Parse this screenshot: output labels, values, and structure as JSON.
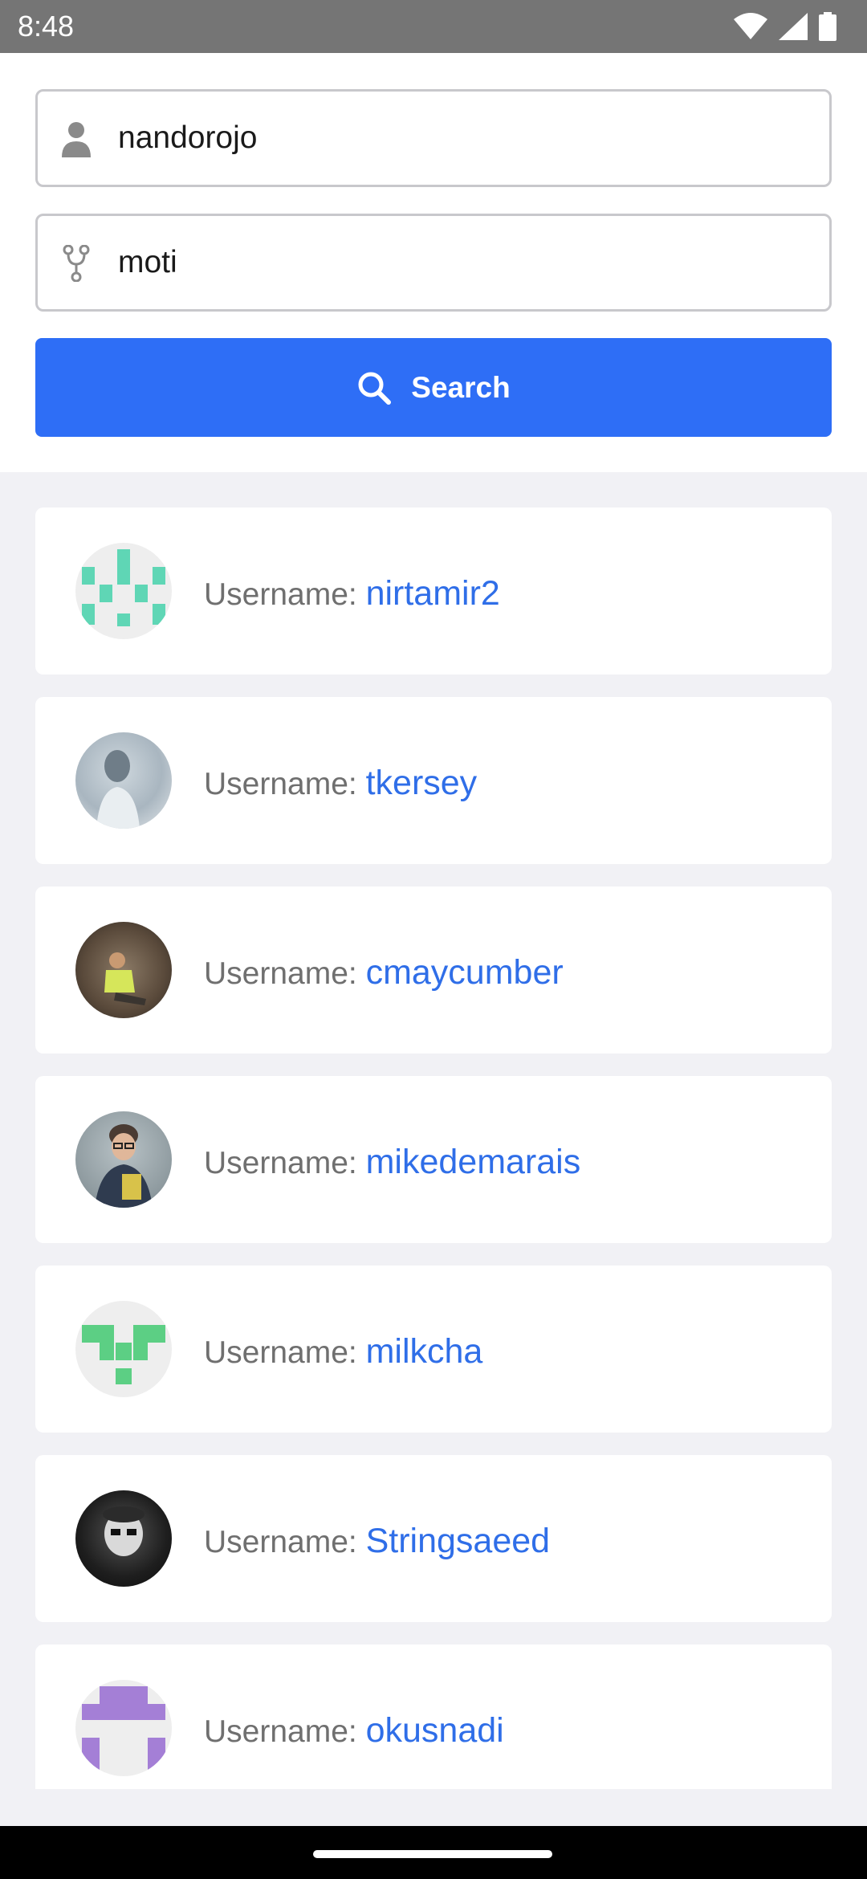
{
  "status_bar": {
    "time": "8:48",
    "icons": [
      "wifi-icon",
      "signal-icon",
      "battery-icon"
    ]
  },
  "form": {
    "username_field": {
      "value": "nandorojo",
      "icon": "person-icon"
    },
    "repo_field": {
      "value": "moti",
      "icon": "git-fork-icon"
    },
    "search_button": {
      "label": "Search",
      "icon": "search-icon",
      "color": "#2e6ef6"
    }
  },
  "results": {
    "label_prefix": "Username:",
    "accent_color": "#2f6ee8",
    "items": [
      {
        "username": "nirtamir2",
        "avatar": "identicon-green"
      },
      {
        "username": "tkersey",
        "avatar": "photo"
      },
      {
        "username": "cmaycumber",
        "avatar": "photo"
      },
      {
        "username": "mikedemarais",
        "avatar": "photo"
      },
      {
        "username": "milkcha",
        "avatar": "identicon-green"
      },
      {
        "username": "Stringsaeed",
        "avatar": "photo"
      },
      {
        "username": "okusnadi",
        "avatar": "identicon-purple"
      }
    ]
  }
}
